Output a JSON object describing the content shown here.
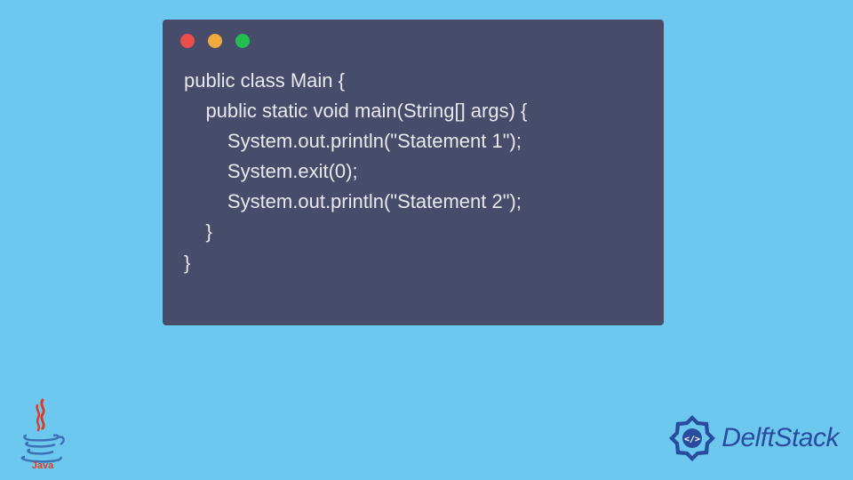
{
  "code": {
    "line1": "public class Main {",
    "line2": "    public static void main(String[] args) {",
    "line3": "        System.out.println(\"Statement 1\");",
    "line4": "        System.exit(0);",
    "line5": "        System.out.println(\"Statement 2\");",
    "line6": "    }",
    "line7": "}"
  },
  "brand": {
    "name": "DelftStack"
  }
}
